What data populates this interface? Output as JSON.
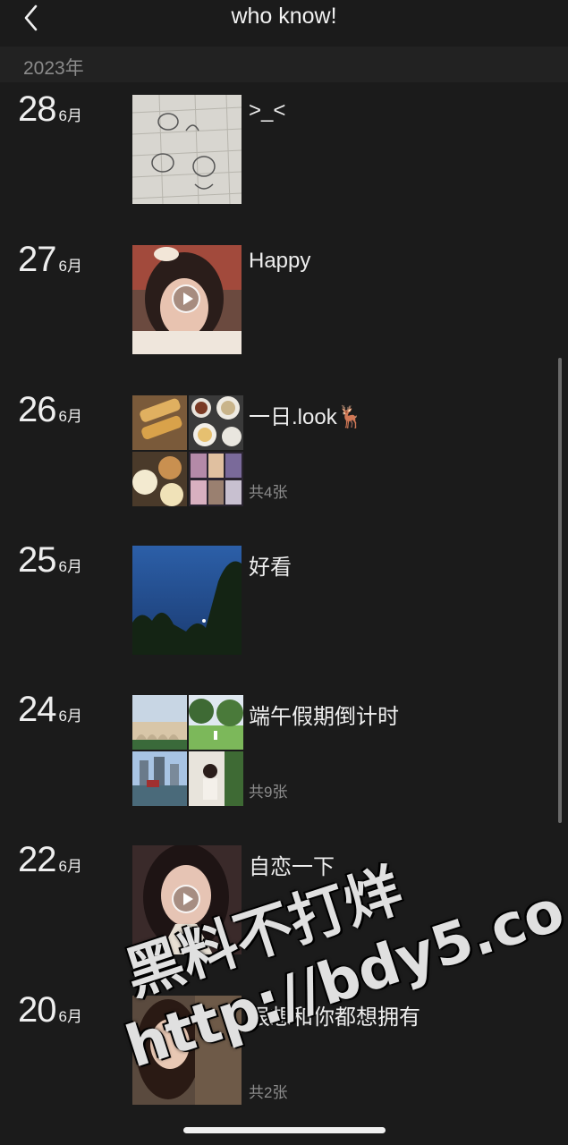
{
  "header": {
    "title": "who know!",
    "back_icon": "chevron-left-icon"
  },
  "year_label": "2023年",
  "entries": [
    {
      "day": "28",
      "month": "6月",
      "caption": ">_<",
      "count": "",
      "type": "photo"
    },
    {
      "day": "27",
      "month": "6月",
      "caption": "Happy",
      "count": "",
      "type": "video"
    },
    {
      "day": "26",
      "month": "6月",
      "caption": "一日.look🦌",
      "count": "共4张",
      "type": "grid"
    },
    {
      "day": "25",
      "month": "6月",
      "caption": "好看",
      "count": "",
      "type": "photo"
    },
    {
      "day": "24",
      "month": "6月",
      "caption": "端午假期倒计时",
      "count": "共9张",
      "type": "grid"
    },
    {
      "day": "22",
      "month": "6月",
      "caption": "自恋一下",
      "count": "",
      "type": "video"
    },
    {
      "day": "20",
      "month": "6月",
      "caption": "很想和你都想拥有",
      "count": "共2张",
      "type": "grid"
    }
  ],
  "watermark": {
    "line1": "黑料不打烊",
    "line2": "http://bdy5.co"
  },
  "colors": {
    "background": "#1b1b1b",
    "text": "#eeeeee",
    "muted": "#8c8c8c"
  }
}
